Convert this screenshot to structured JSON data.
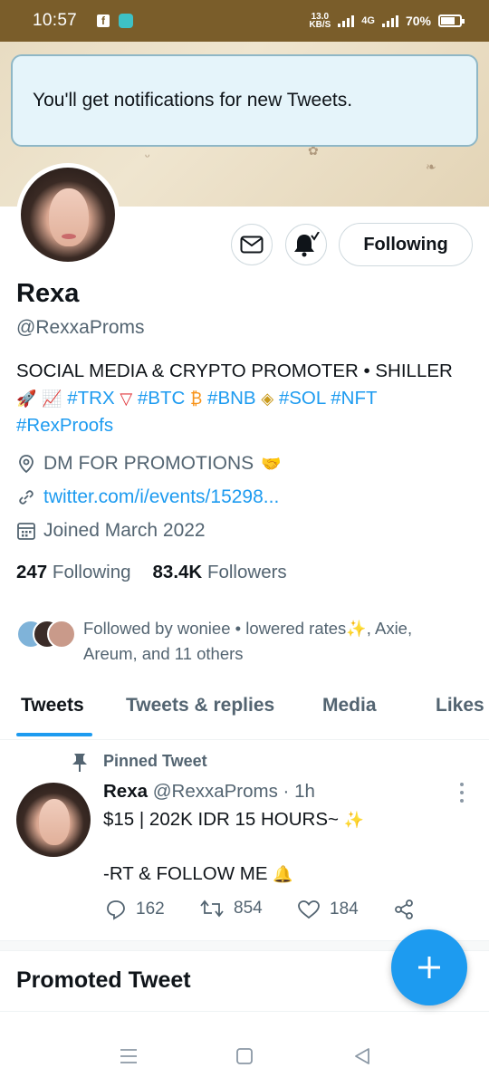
{
  "status_bar": {
    "time": "10:57",
    "net_speed_value": "13.0",
    "net_speed_unit": "KB/S",
    "network": "4G",
    "battery": "70%"
  },
  "toast": {
    "message": "You'll get notifications for new Tweets."
  },
  "profile": {
    "name": "Rexa",
    "handle": "@RexxaProms",
    "following_button": "Following",
    "bio_line1": "SOCIAL MEDIA & CRYPTO PROMOTER • SHILLER",
    "bio_tags": [
      "#TRX",
      "#BTC",
      "#BNB",
      "#SOL",
      "#NFT",
      "#RexProofs"
    ],
    "location": "DM FOR PROMOTIONS",
    "website": "twitter.com/i/events/15298...",
    "joined": "Joined March 2022",
    "following_count": "247",
    "following_label": "Following",
    "followers_count": "83.4K",
    "followers_label": "Followers",
    "followed_by_line1": "Followed by woniee • lowered rates",
    "followed_by_line1_end": ", Axie,",
    "followed_by_line2": "Areum, and 11 others"
  },
  "tabs": [
    {
      "label": "Tweets",
      "active": true
    },
    {
      "label": "Tweets & replies",
      "active": false
    },
    {
      "label": "Media",
      "active": false
    },
    {
      "label": "Likes",
      "active": false
    }
  ],
  "pinned_tweet": {
    "label": "Pinned Tweet",
    "author_name": "Rexa",
    "author_meta": "@RexxaProms · 1h",
    "line1": "$15 | 202K IDR 15 HOURS~",
    "line2": "-RT & FOLLOW ME",
    "replies": "162",
    "retweets": "854",
    "likes": "184"
  },
  "promoted": {
    "title": "Promoted Tweet"
  },
  "colors": {
    "accent": "#1d9bf0",
    "status_bar": "#7a5d2a",
    "secondary_text": "#536471"
  },
  "icons": [
    "mail-icon",
    "bell-icon",
    "location-icon",
    "link-icon",
    "calendar-icon",
    "pin-icon",
    "reply-icon",
    "retweet-icon",
    "like-icon",
    "share-icon",
    "compose-icon"
  ]
}
